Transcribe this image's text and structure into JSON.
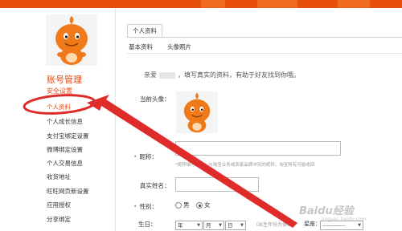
{
  "colors": {
    "brand": "#e8470b",
    "annotation": "#e02b2b"
  },
  "sidebar": {
    "avatar_icon": "orange-mascot-icon",
    "title": "账号管理",
    "active_item": "安全设置",
    "items": [
      {
        "label": "个人资料"
      },
      {
        "label": "个人成长信息"
      },
      {
        "label": "支付宝绑定设置"
      },
      {
        "label": "微博绑定设置"
      },
      {
        "label": "个人交易信息"
      },
      {
        "label": "收货地址"
      },
      {
        "label": "旺旺网页新设置"
      },
      {
        "label": "应用授权"
      },
      {
        "label": "分享绑定"
      }
    ]
  },
  "main": {
    "tab": "个人资料",
    "subtabs": [
      "基本资料",
      "头像照片"
    ],
    "greeting_prefix": "亲爱",
    "greeting_suffix": "，填写真实的资料，有助于好友找到你哦。",
    "avatar_label": "当前头像：",
    "nickname_label": "昵称：",
    "nickname_hint": "*昵称填写须知：与淘宝业务或卖家品牌冲突的昵称，淘宝将有可能收回",
    "realname_label": "真实姓名：",
    "gender_label": "性别：",
    "gender_male": "男",
    "gender_female": "女",
    "birthday_label": "生日：",
    "year_label": "年",
    "month_label": "月",
    "day_label": "日",
    "birthday_hint": "（出生年份为保密）",
    "zodiac_label": "星座：",
    "zodiac_value": "------------"
  },
  "watermark": {
    "text": "Baidu经验",
    "sub": "jingyan.baidu.com"
  }
}
